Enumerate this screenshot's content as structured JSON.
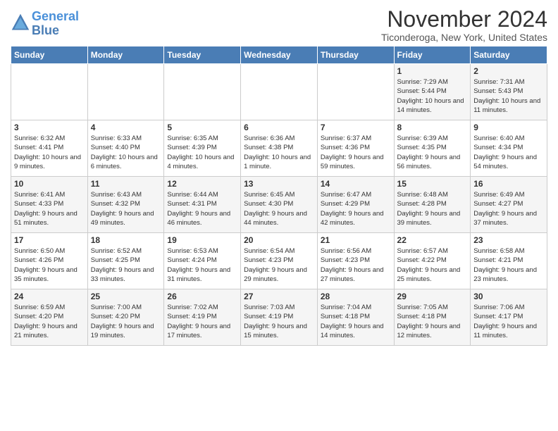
{
  "header": {
    "logo_line1": "General",
    "logo_line2": "Blue",
    "month_title": "November 2024",
    "subtitle": "Ticonderoga, New York, United States"
  },
  "days_of_week": [
    "Sunday",
    "Monday",
    "Tuesday",
    "Wednesday",
    "Thursday",
    "Friday",
    "Saturday"
  ],
  "weeks": [
    [
      {
        "day": "",
        "info": ""
      },
      {
        "day": "",
        "info": ""
      },
      {
        "day": "",
        "info": ""
      },
      {
        "day": "",
        "info": ""
      },
      {
        "day": "",
        "info": ""
      },
      {
        "day": "1",
        "info": "Sunrise: 7:29 AM\nSunset: 5:44 PM\nDaylight: 10 hours and 14 minutes."
      },
      {
        "day": "2",
        "info": "Sunrise: 7:31 AM\nSunset: 5:43 PM\nDaylight: 10 hours and 11 minutes."
      }
    ],
    [
      {
        "day": "3",
        "info": "Sunrise: 6:32 AM\nSunset: 4:41 PM\nDaylight: 10 hours and 9 minutes."
      },
      {
        "day": "4",
        "info": "Sunrise: 6:33 AM\nSunset: 4:40 PM\nDaylight: 10 hours and 6 minutes."
      },
      {
        "day": "5",
        "info": "Sunrise: 6:35 AM\nSunset: 4:39 PM\nDaylight: 10 hours and 4 minutes."
      },
      {
        "day": "6",
        "info": "Sunrise: 6:36 AM\nSunset: 4:38 PM\nDaylight: 10 hours and 1 minute."
      },
      {
        "day": "7",
        "info": "Sunrise: 6:37 AM\nSunset: 4:36 PM\nDaylight: 9 hours and 59 minutes."
      },
      {
        "day": "8",
        "info": "Sunrise: 6:39 AM\nSunset: 4:35 PM\nDaylight: 9 hours and 56 minutes."
      },
      {
        "day": "9",
        "info": "Sunrise: 6:40 AM\nSunset: 4:34 PM\nDaylight: 9 hours and 54 minutes."
      }
    ],
    [
      {
        "day": "10",
        "info": "Sunrise: 6:41 AM\nSunset: 4:33 PM\nDaylight: 9 hours and 51 minutes."
      },
      {
        "day": "11",
        "info": "Sunrise: 6:43 AM\nSunset: 4:32 PM\nDaylight: 9 hours and 49 minutes."
      },
      {
        "day": "12",
        "info": "Sunrise: 6:44 AM\nSunset: 4:31 PM\nDaylight: 9 hours and 46 minutes."
      },
      {
        "day": "13",
        "info": "Sunrise: 6:45 AM\nSunset: 4:30 PM\nDaylight: 9 hours and 44 minutes."
      },
      {
        "day": "14",
        "info": "Sunrise: 6:47 AM\nSunset: 4:29 PM\nDaylight: 9 hours and 42 minutes."
      },
      {
        "day": "15",
        "info": "Sunrise: 6:48 AM\nSunset: 4:28 PM\nDaylight: 9 hours and 39 minutes."
      },
      {
        "day": "16",
        "info": "Sunrise: 6:49 AM\nSunset: 4:27 PM\nDaylight: 9 hours and 37 minutes."
      }
    ],
    [
      {
        "day": "17",
        "info": "Sunrise: 6:50 AM\nSunset: 4:26 PM\nDaylight: 9 hours and 35 minutes."
      },
      {
        "day": "18",
        "info": "Sunrise: 6:52 AM\nSunset: 4:25 PM\nDaylight: 9 hours and 33 minutes."
      },
      {
        "day": "19",
        "info": "Sunrise: 6:53 AM\nSunset: 4:24 PM\nDaylight: 9 hours and 31 minutes."
      },
      {
        "day": "20",
        "info": "Sunrise: 6:54 AM\nSunset: 4:23 PM\nDaylight: 9 hours and 29 minutes."
      },
      {
        "day": "21",
        "info": "Sunrise: 6:56 AM\nSunset: 4:23 PM\nDaylight: 9 hours and 27 minutes."
      },
      {
        "day": "22",
        "info": "Sunrise: 6:57 AM\nSunset: 4:22 PM\nDaylight: 9 hours and 25 minutes."
      },
      {
        "day": "23",
        "info": "Sunrise: 6:58 AM\nSunset: 4:21 PM\nDaylight: 9 hours and 23 minutes."
      }
    ],
    [
      {
        "day": "24",
        "info": "Sunrise: 6:59 AM\nSunset: 4:20 PM\nDaylight: 9 hours and 21 minutes."
      },
      {
        "day": "25",
        "info": "Sunrise: 7:00 AM\nSunset: 4:20 PM\nDaylight: 9 hours and 19 minutes."
      },
      {
        "day": "26",
        "info": "Sunrise: 7:02 AM\nSunset: 4:19 PM\nDaylight: 9 hours and 17 minutes."
      },
      {
        "day": "27",
        "info": "Sunrise: 7:03 AM\nSunset: 4:19 PM\nDaylight: 9 hours and 15 minutes."
      },
      {
        "day": "28",
        "info": "Sunrise: 7:04 AM\nSunset: 4:18 PM\nDaylight: 9 hours and 14 minutes."
      },
      {
        "day": "29",
        "info": "Sunrise: 7:05 AM\nSunset: 4:18 PM\nDaylight: 9 hours and 12 minutes."
      },
      {
        "day": "30",
        "info": "Sunrise: 7:06 AM\nSunset: 4:17 PM\nDaylight: 9 hours and 11 minutes."
      }
    ]
  ]
}
